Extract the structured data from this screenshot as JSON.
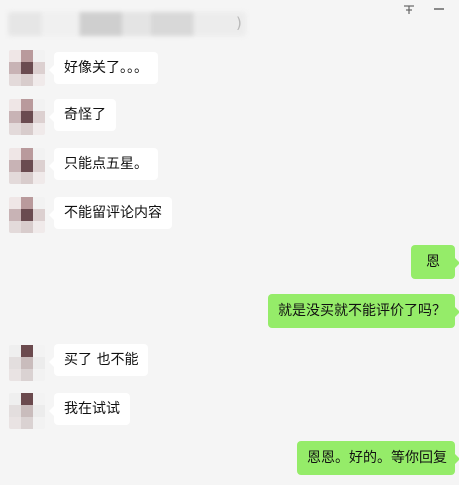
{
  "window": {
    "title_suffix": ")",
    "icons": [
      "pin-icon",
      "minimize-icon"
    ]
  },
  "messages": [
    {
      "side": "left",
      "text": "好像关了。。。"
    },
    {
      "side": "left",
      "text": "奇怪了"
    },
    {
      "side": "left",
      "text": "只能点五星。"
    },
    {
      "side": "left",
      "text": "不能留评论内容"
    },
    {
      "side": "right",
      "text": "恩"
    },
    {
      "side": "right",
      "text": "就是没买就不能评价了吗？"
    },
    {
      "side": "left",
      "text": "买了 也不能"
    },
    {
      "side": "left",
      "text": "我在试试"
    },
    {
      "side": "right",
      "text": "恩恩。好的。等你回复"
    }
  ],
  "colors": {
    "background": "#f5f5f5",
    "bubble_left": "#ffffff",
    "bubble_right": "#95ec69"
  }
}
